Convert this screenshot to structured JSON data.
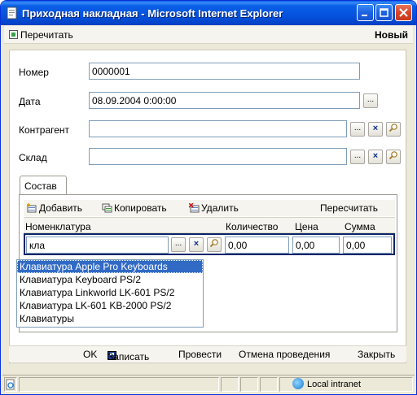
{
  "window": {
    "title": "Приходная накладная - Microsoft Internet Explorer"
  },
  "menubar": {
    "reread_label": "Перечитать",
    "new_label": "Новый"
  },
  "form": {
    "number": {
      "label": "Номер",
      "value": "0000001"
    },
    "date": {
      "label": "Дата",
      "value": "08.09.2004 0:00:00",
      "select_label": "..."
    },
    "counterparty": {
      "label": "Контрагент",
      "value": "",
      "select_label": "...",
      "clear_label": "×"
    },
    "warehouse": {
      "label": "Склад",
      "value": "",
      "select_label": "...",
      "clear_label": "×"
    }
  },
  "tab": {
    "label": "Состав"
  },
  "table_toolbar": {
    "add_label": "Добавить",
    "copy_label": "Копировать",
    "delete_label": "Удалить",
    "recalc_label": "Пересчитать"
  },
  "table": {
    "columns": [
      "Номенклатура",
      "Количество",
      "Цена",
      "Сумма"
    ],
    "row": {
      "nomenclature": "кла",
      "quantity": "0,00",
      "price": "0,00",
      "sum": "0,00",
      "select_label": "...",
      "clear_label": "×"
    }
  },
  "autocomplete": {
    "items": [
      "Клавиатура Apple Pro Keyboards",
      "Клавиатура Keyboard PS/2",
      "Клавиатура Linkworld LK-601 PS/2",
      "Клавиатура LK-601 KB-2000 PS/2",
      "Клавиатуры"
    ],
    "selected_index": 0
  },
  "actions": {
    "ok_label": "OK",
    "save_label": "Записать",
    "post_label": "Провести",
    "unpost_label": "Отмена проведения",
    "close_label": "Закрыть"
  },
  "statusbar": {
    "zone": "Local intranet"
  },
  "colors": {
    "titlebar": "#0552de",
    "selection": "#316ac5",
    "row_border": "#0a246a"
  }
}
